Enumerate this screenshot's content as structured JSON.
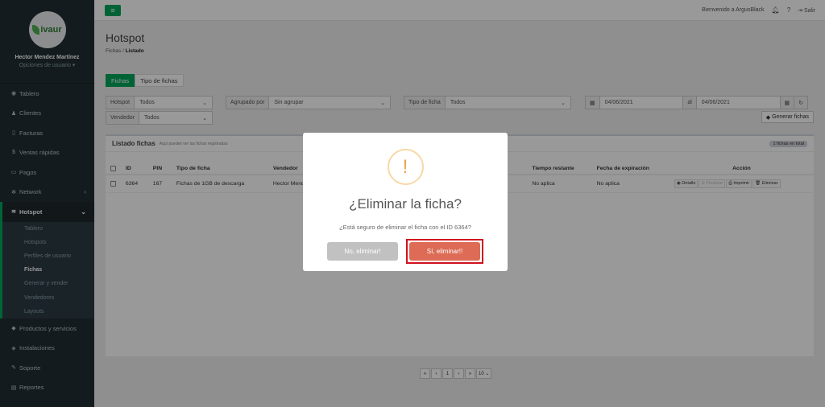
{
  "user": {
    "avatar_text": "ivaur",
    "name": "Hector Mendez Martínez",
    "options": "Opciones de usuario ▾"
  },
  "sidebar": {
    "items": [
      {
        "label": "Tablero",
        "icon": "dashboard-icon"
      },
      {
        "label": "Clientes",
        "icon": "users-icon"
      },
      {
        "label": "Facturas",
        "icon": "file-icon"
      },
      {
        "label": "Ventas rápidas",
        "icon": "dollar-icon"
      },
      {
        "label": "Pagos",
        "icon": "money-icon"
      },
      {
        "label": "Network",
        "icon": "network-icon"
      },
      {
        "label": "Hotspot",
        "icon": "wifi-icon"
      }
    ],
    "sub": [
      "Tablero",
      "Hotspots",
      "Perfiles de usuario",
      "Fichas",
      "Generar y vender",
      "Vendedores",
      "Layouts"
    ],
    "items_after": [
      {
        "label": "Productos y servicios",
        "icon": "tag-icon"
      },
      {
        "label": "Instalaciones",
        "icon": "install-icon"
      },
      {
        "label": "Soporte",
        "icon": "wrench-icon"
      },
      {
        "label": "Reportes",
        "icon": "chart-icon"
      }
    ]
  },
  "topbar": {
    "welcome": "Bienvenido a ArgusBlack",
    "logout": "Salir"
  },
  "page": {
    "title": "Hotspot",
    "crumb_parent": "Fichas",
    "crumb_current": "Listado"
  },
  "tabs": [
    "Fichas",
    "Tipo de fichas"
  ],
  "filters": {
    "estado_label": "Hotspot",
    "estado_value": "Todos",
    "agrupado_label": "Agrupado por",
    "agrupado_value": "Sin agrupar",
    "tipo_label": "Tipo de ficha",
    "tipo_value": "Todos",
    "date_from": "04/06/2021",
    "al_label": "al",
    "date_to": "04/06/2021",
    "vendedor_label": "Vendedor",
    "vendedor_value": "Todos",
    "generate_label": "Generar fichas"
  },
  "panel": {
    "title": "Listado fichas",
    "subtitle": "Aquí puedes ver las fichas registradas",
    "badge": "1 fichas en total"
  },
  "table": {
    "headers": [
      "ID",
      "PIN",
      "Tipo de ficha",
      "Vendedor",
      "Tiempo restante",
      "Fecha de expiración",
      "Acción"
    ],
    "rows": [
      {
        "id": "6364",
        "pin": "167",
        "tipo": "Fichas de 1GB de descarga",
        "vendedor": "Hector Mend",
        "tiempo": "No aplica",
        "expira": "No aplica"
      }
    ],
    "actions": [
      "Detalle",
      "Finalizar",
      "Imprimir",
      "Eliminar"
    ]
  },
  "pagination": {
    "first": "«",
    "prev": "‹",
    "page": "1",
    "next": "›",
    "last": "»",
    "size": "10"
  },
  "modal": {
    "title": "¿Eliminar la ficha?",
    "text": "¿Está seguro de eliminar el ficha con el ID 6364?",
    "cancel": "No, eliminar!",
    "confirm": "Sí, eliminar!!"
  }
}
